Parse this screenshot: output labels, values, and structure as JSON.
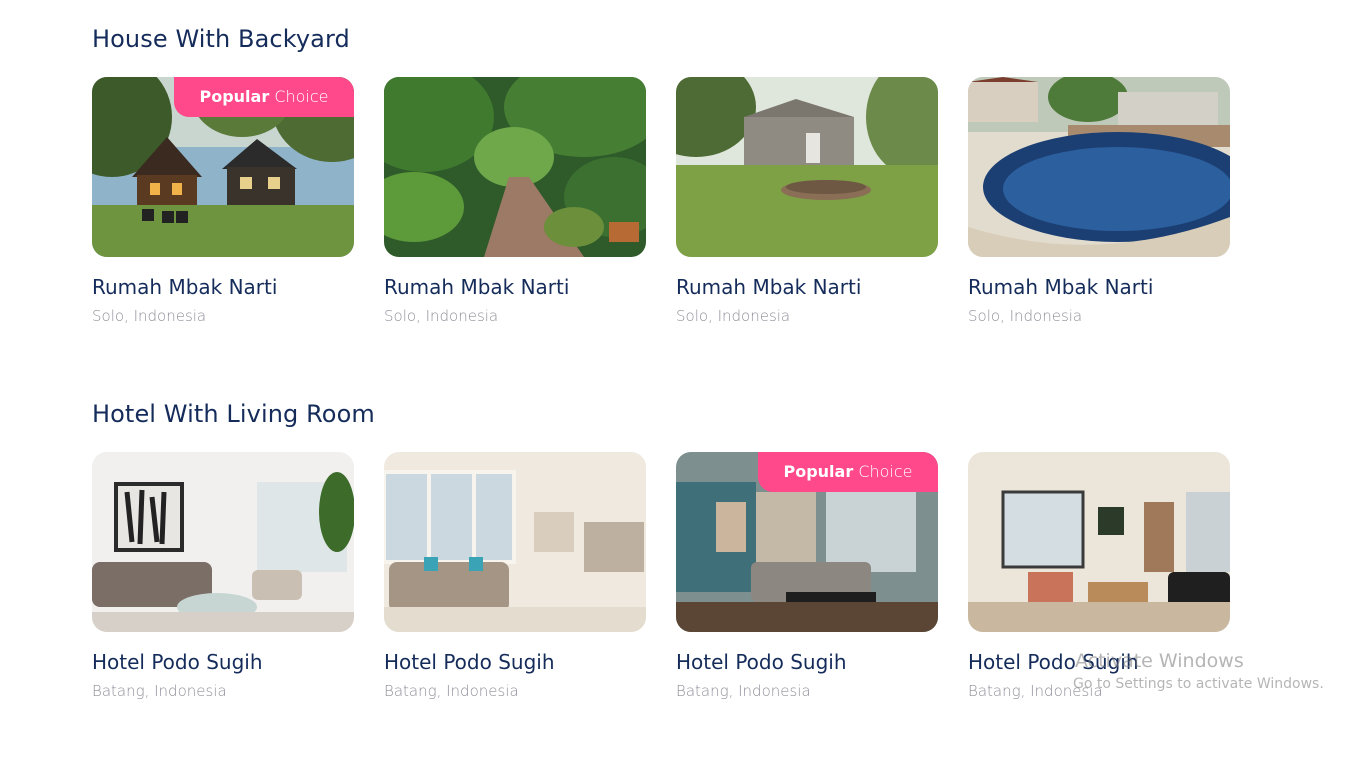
{
  "sections": [
    {
      "title": "House With Backyard",
      "cards": [
        {
          "name": "Rumah Mbak Narti",
          "location": "Solo, Indonesia",
          "popular": true,
          "image": "house-backyard-evening-image"
        },
        {
          "name": "Rumah Mbak Narti",
          "location": "Solo, Indonesia",
          "popular": false,
          "image": "tropical-garden-path-image"
        },
        {
          "name": "Rumah Mbak Narti",
          "location": "Solo, Indonesia",
          "popular": false,
          "image": "wooden-cabin-lawn-image"
        },
        {
          "name": "Rumah Mbak Narti",
          "location": "Solo, Indonesia",
          "popular": false,
          "image": "backyard-pool-image"
        }
      ]
    },
    {
      "title": "Hotel With Living Room",
      "cards": [
        {
          "name": "Hotel Podo Sugih",
          "location": "Batang, Indonesia",
          "popular": false,
          "image": "white-living-room-image"
        },
        {
          "name": "Hotel Podo Sugih",
          "location": "Batang, Indonesia",
          "popular": false,
          "image": "bright-open-living-room-image"
        },
        {
          "name": "Hotel Podo Sugih",
          "location": "Batang, Indonesia",
          "popular": true,
          "image": "teal-wall-living-room-image"
        },
        {
          "name": "Hotel Podo Sugih",
          "location": "Batang, Indonesia",
          "popular": false,
          "image": "modern-living-room-image"
        }
      ]
    }
  ],
  "badge": {
    "word1": "Popular",
    "word2": "Choice"
  },
  "watermark": {
    "line1": "Activate Windows",
    "line2": "Go to Settings to activate Windows."
  },
  "colors": {
    "title": "#152c5b",
    "muted": "#8e8e99",
    "badge": "#ff498b"
  }
}
